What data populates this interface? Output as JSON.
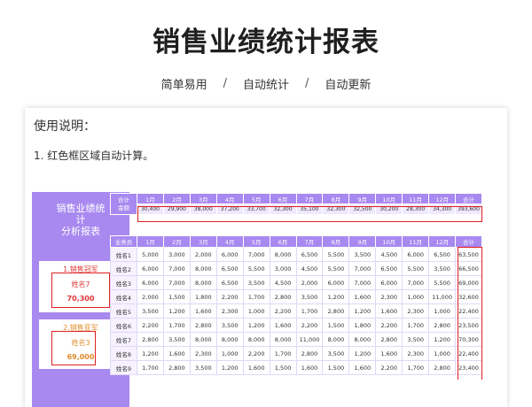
{
  "title": "销售业绩统计报表",
  "subnav": {
    "items": [
      "简单易用",
      "自动统计",
      "自动更新"
    ],
    "separator": "/"
  },
  "usage": {
    "title": "使用说明：",
    "line1": "1. 红色框区域自动计算。"
  },
  "panel": {
    "title_line1": "销售业绩统",
    "title_line2": "计",
    "title_line3": "分析报表",
    "first": {
      "label": "1.销售冠军",
      "name": "姓名7",
      "value": "70,300"
    },
    "second": {
      "label": "2.销售亚军",
      "name": "姓名3",
      "value": "69,000"
    }
  },
  "summary": {
    "corner_line1": "合计",
    "corner_line2": "金额",
    "months": [
      "1月",
      "2月",
      "3月",
      "4月",
      "5月",
      "6月",
      "7月",
      "8月",
      "9月",
      "10月",
      "11月",
      "12月",
      "合计"
    ],
    "values": [
      "30,400",
      "29,900",
      "38,000",
      "37,200",
      "33,700",
      "32,300",
      "35,100",
      "32,300",
      "32,500",
      "30,200",
      "28,300",
      "34,300",
      "393,600"
    ]
  },
  "table": {
    "headers": [
      "业务员",
      "1月",
      "2月",
      "3月",
      "4月",
      "5月",
      "6月",
      "7月",
      "8月",
      "9月",
      "10月",
      "11月",
      "12月",
      "合计"
    ],
    "rows": [
      [
        "姓名1",
        "5,000",
        "3,000",
        "2,000",
        "6,000",
        "7,000",
        "8,000",
        "6,500",
        "5,500",
        "3,500",
        "4,500",
        "6,000",
        "6,500",
        "63,500"
      ],
      [
        "姓名2",
        "6,000",
        "7,000",
        "8,000",
        "6,500",
        "5,500",
        "3,000",
        "4,500",
        "5,500",
        "7,000",
        "6,500",
        "5,500",
        "3,500",
        "66,500"
      ],
      [
        "姓名3",
        "6,000",
        "7,000",
        "8,000",
        "6,500",
        "3,500",
        "4,500",
        "2,000",
        "6,000",
        "7,000",
        "6,000",
        "7,000",
        "5,500",
        "69,000"
      ],
      [
        "姓名4",
        "2,000",
        "1,500",
        "1,800",
        "2,200",
        "1,700",
        "2,800",
        "3,500",
        "1,200",
        "1,600",
        "2,300",
        "1,000",
        "11,000",
        "32,600"
      ],
      [
        "姓名5",
        "3,500",
        "1,200",
        "1,600",
        "2,300",
        "1,000",
        "2,200",
        "1,700",
        "2,800",
        "1,200",
        "1,600",
        "2,300",
        "1,000",
        "22,400"
      ],
      [
        "姓名6",
        "2,200",
        "1,700",
        "2,800",
        "3,500",
        "1,200",
        "1,600",
        "2,200",
        "1,500",
        "1,800",
        "2,200",
        "1,700",
        "2,800",
        "23,500"
      ],
      [
        "姓名7",
        "2,800",
        "3,500",
        "8,000",
        "8,000",
        "8,000",
        "8,000",
        "11,000",
        "8,000",
        "8,000",
        "2,800",
        "3,500",
        "1,200",
        "70,300"
      ],
      [
        "姓名8",
        "1,200",
        "1,600",
        "2,300",
        "1,000",
        "2,200",
        "1,700",
        "2,800",
        "3,500",
        "1,200",
        "1,600",
        "2,300",
        "1,000",
        "22,400"
      ],
      [
        "姓名9",
        "1,700",
        "2,800",
        "3,500",
        "1,200",
        "1,600",
        "1,500",
        "1,600",
        "1,500",
        "1,600",
        "2,200",
        "1,700",
        "2,800",
        "23,400"
      ]
    ]
  },
  "colors": {
    "accent": "#a889f0",
    "highlight": "#e02020",
    "value_bg": "#efe9fd"
  }
}
